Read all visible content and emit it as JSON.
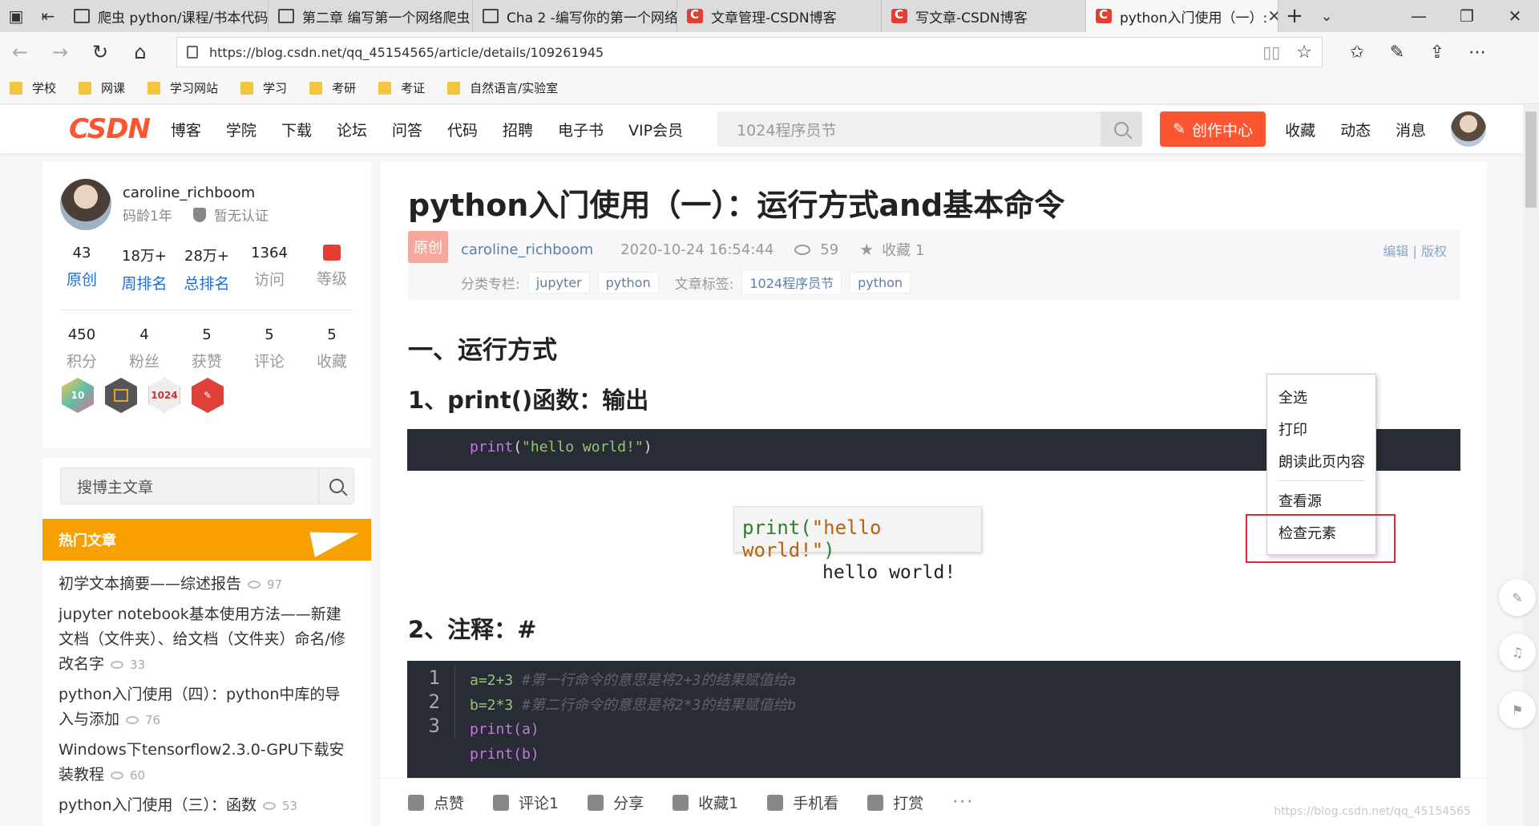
{
  "browser": {
    "tabs": [
      {
        "title": "爬虫 python/课程/书本代码",
        "icon": "page"
      },
      {
        "title": "第二章 编写第一个网络爬虫",
        "icon": "page"
      },
      {
        "title": "Cha 2 -编写你的第一个网络",
        "icon": "page"
      },
      {
        "title": "文章管理-CSDN博客",
        "icon": "csdn"
      },
      {
        "title": "写文章-CSDN博客",
        "icon": "csdn"
      },
      {
        "title": "python入门使用（一）:",
        "icon": "csdn",
        "active": true
      }
    ],
    "url": "https://blog.csdn.net/qq_45154565/article/details/109261945",
    "favorites": [
      "学校",
      "网课",
      "学习网站",
      "学习",
      "考研",
      "考证",
      "自然语言/实验室"
    ]
  },
  "csdn_header": {
    "logo": "CSDN",
    "nav": [
      "博客",
      "学院",
      "下载",
      "论坛",
      "问答",
      "代码",
      "招聘",
      "电子书",
      "VIP会员"
    ],
    "search_placeholder": "1024程序员节",
    "create_label": "创作中心",
    "right_links": [
      "收藏",
      "动态",
      "消息"
    ]
  },
  "profile": {
    "username": "caroline_richboom",
    "age": "码龄1年",
    "cert": "暂无认证",
    "stats_row1": [
      {
        "value": "43",
        "label": "原创"
      },
      {
        "value": "18万+",
        "label": "周排名"
      },
      {
        "value": "28万+",
        "label": "总排名"
      },
      {
        "value": "1364",
        "label": "访问"
      },
      {
        "value": "",
        "label": "等级"
      }
    ],
    "stats_row2": [
      {
        "value": "450",
        "label": "积分"
      },
      {
        "value": "4",
        "label": "粉丝"
      },
      {
        "value": "5",
        "label": "获赞"
      },
      {
        "value": "5",
        "label": "评论"
      },
      {
        "value": "5",
        "label": "收藏"
      }
    ],
    "badges": [
      "10",
      "",
      "1024",
      ""
    ]
  },
  "sidebar_search": {
    "placeholder": "搜博主文章"
  },
  "hot": {
    "title": "热门文章",
    "items": [
      {
        "title": "初学文本摘要——综述报告",
        "views": "97"
      },
      {
        "title": "jupyter notebook基本使用方法——新建文档（文件夹）、给文档（文件夹）命名/修改名字",
        "views": "33"
      },
      {
        "title": "python入门使用（四）：python中库的导入与添加",
        "views": "76"
      },
      {
        "title": "Windows下tensorflow2.3.0-GPU下载安装教程",
        "views": "60"
      },
      {
        "title": "python入门使用（三）：函数",
        "views": "53"
      }
    ]
  },
  "article": {
    "title": "python入门使用（一）：运行方式and基本命令",
    "original_tag": "原创",
    "author": "caroline_richboom",
    "date": "2020-10-24 16:54:44",
    "views": "59",
    "fav": "收藏 1",
    "edit": "编辑",
    "copyright": "版权",
    "category_label": "分类专栏:",
    "categories": [
      "jupyter",
      "python"
    ],
    "tag_label": "文章标签:",
    "tags": [
      "1024程序员节",
      "python"
    ],
    "h1": "一、运行方式",
    "h2a": "1、print()函数：输出",
    "code1": {
      "fn": "print",
      "open": "(",
      "str": "\"hello world!\"",
      "close": ")"
    },
    "demo_fn": "print(",
    "demo_str": "\"hello world!\"",
    "demo_close": ")",
    "demo_output": "hello world!",
    "h2b": "2、注释：#",
    "code2": {
      "line_numbers": [
        "1",
        "2",
        "3"
      ],
      "lines": [
        {
          "code": "a=2+3",
          "comment": "#第一行命令的意思是将2+3的结果赋值给a"
        },
        {
          "code": "b=2*3",
          "comment": "#第二行命令的意思是将2*3的结果赋值给b"
        },
        {
          "code": "print(a)",
          "comment": ""
        },
        {
          "code": "print(b)",
          "comment": ""
        }
      ]
    },
    "actions": [
      "点赞",
      "评论1",
      "分享",
      "收藏1",
      "手机看",
      "打赏"
    ],
    "watermark": "https://blog.csdn.net/qq_45154565"
  },
  "context_menu": {
    "items": [
      "全选",
      "打印",
      "朗读此页内容",
      "查看源",
      "检查元素"
    ]
  }
}
